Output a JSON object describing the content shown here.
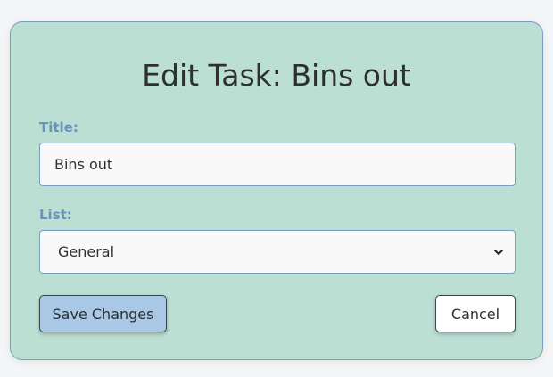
{
  "form": {
    "heading": "Edit Task: Bins out",
    "title_label": "Title:",
    "title_value": "Bins out",
    "list_label": "List:",
    "list_selected": "General",
    "save_label": "Save Changes",
    "cancel_label": "Cancel"
  },
  "colors": {
    "card_background": "#bbdfd3",
    "label_color": "#6993bd",
    "save_button": "#a8c8e6"
  },
  "icons": {
    "select_arrow": "chevron-down-icon"
  }
}
